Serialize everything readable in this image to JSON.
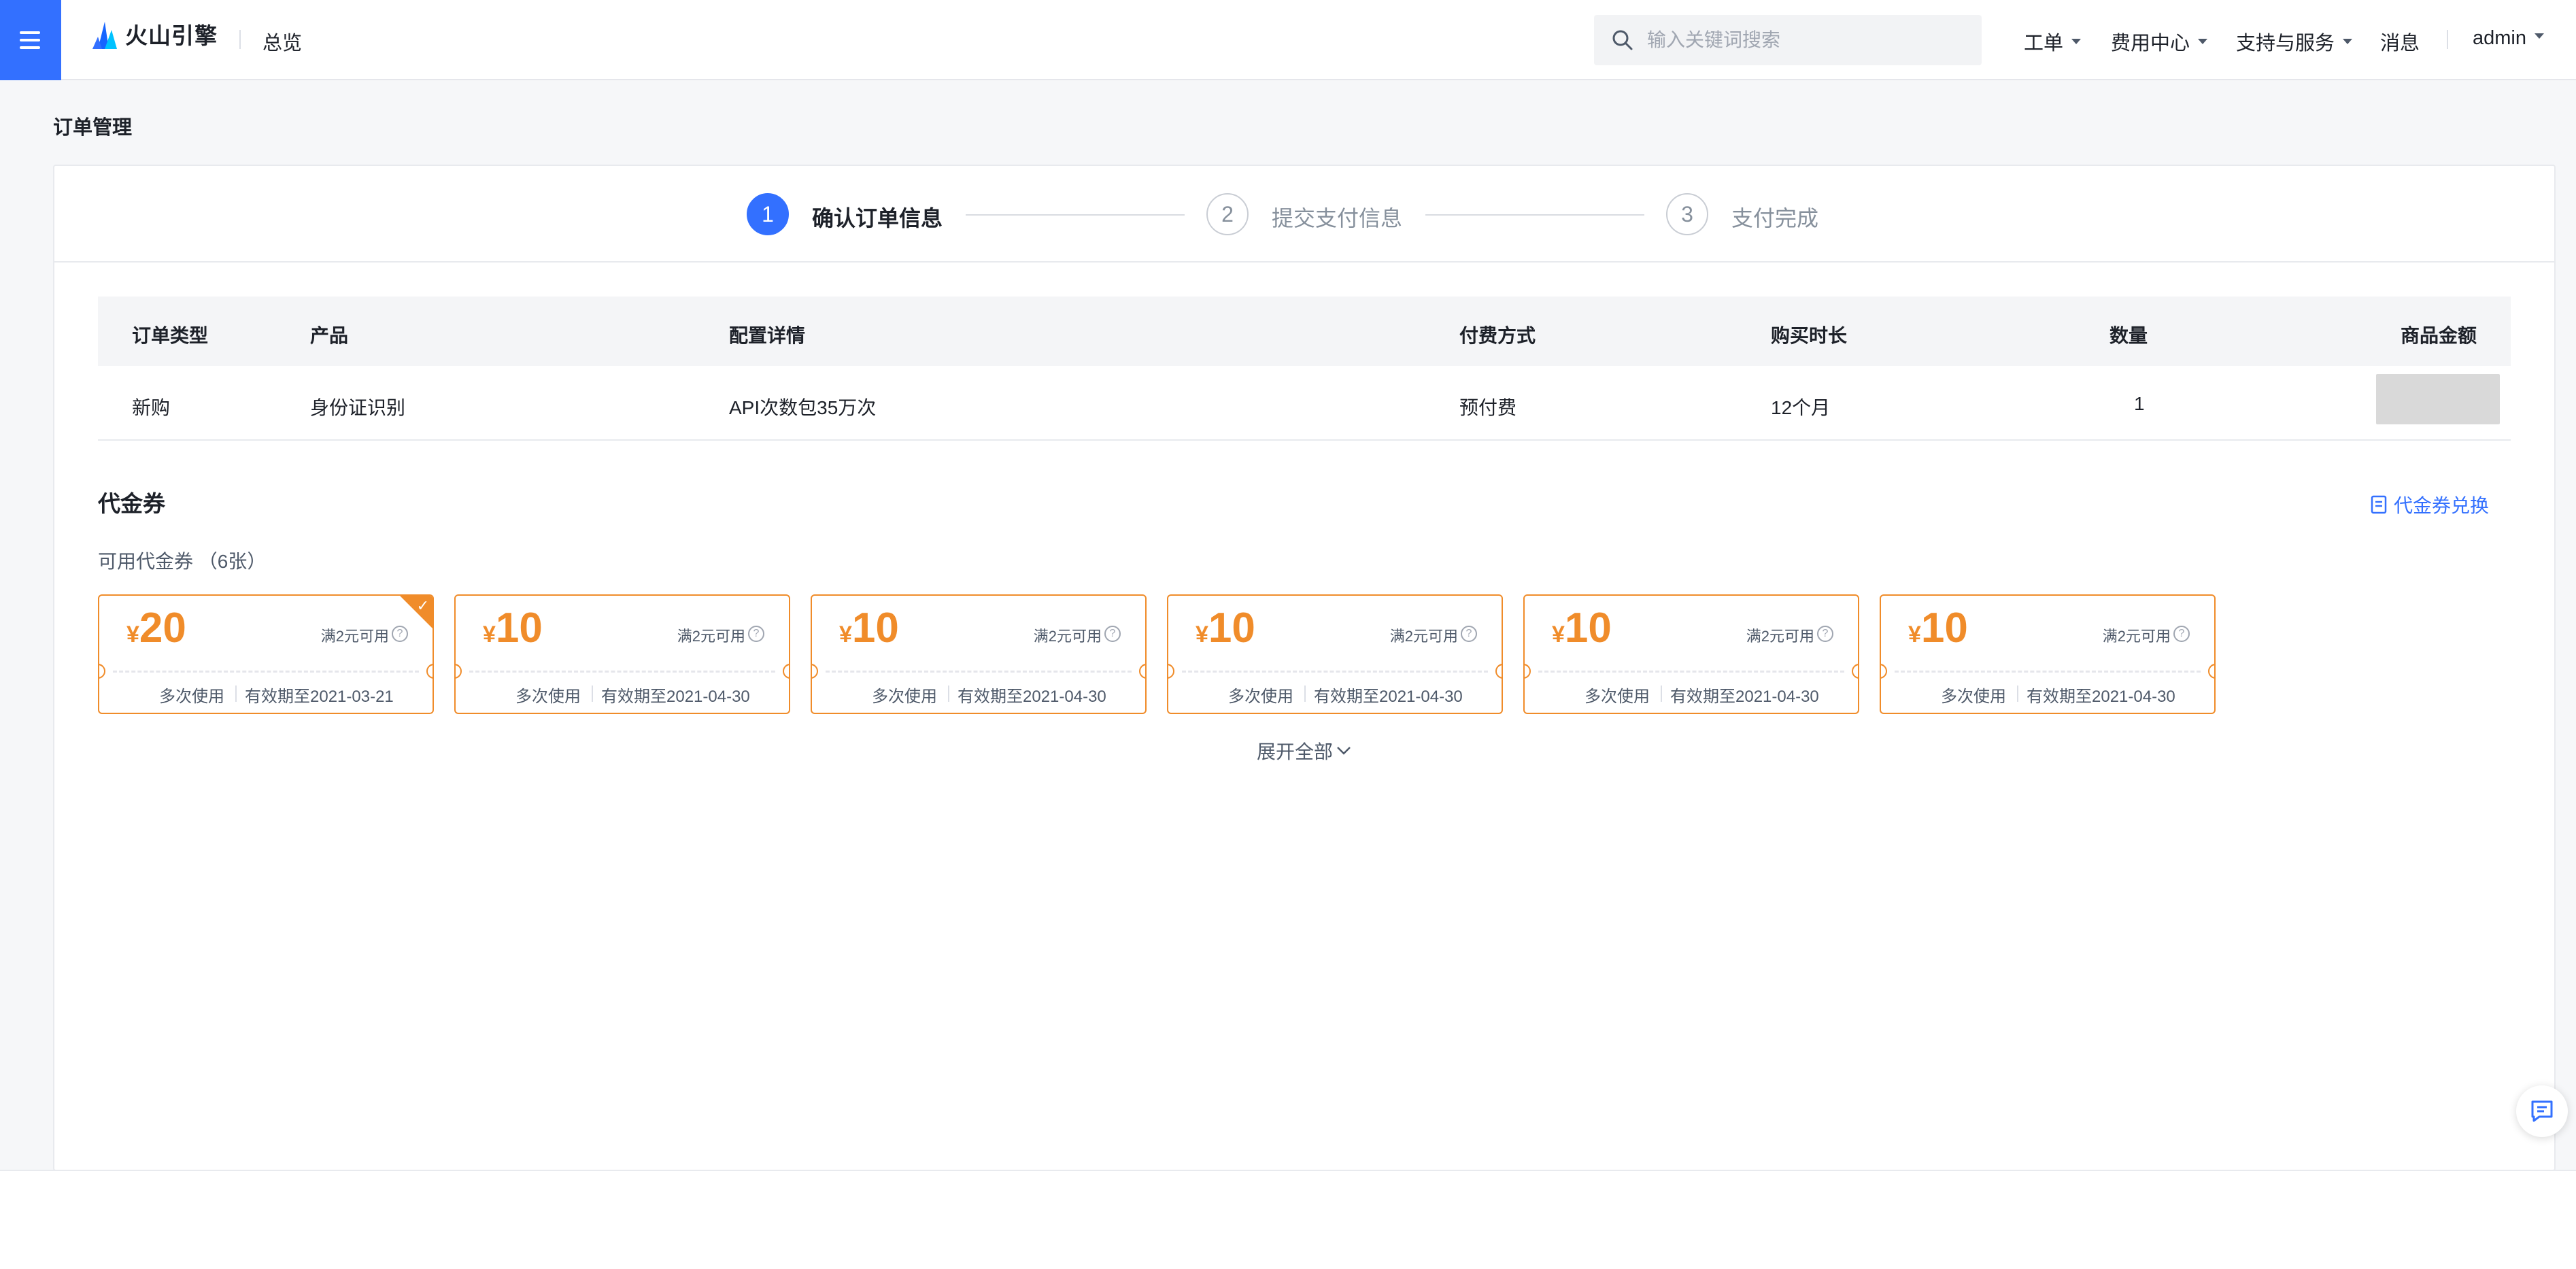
{
  "header": {
    "brand": "火山引擎",
    "overview": "总览",
    "search_placeholder": "输入关键词搜索",
    "nav": [
      "工单",
      "费用中心",
      "支持与服务",
      "消息"
    ],
    "user": "admin"
  },
  "page_title": "订单管理",
  "steps": [
    {
      "num": "1",
      "label": "确认订单信息",
      "active": true
    },
    {
      "num": "2",
      "label": "提交支付信息",
      "active": false
    },
    {
      "num": "3",
      "label": "支付完成",
      "active": false
    }
  ],
  "order_table": {
    "headers": [
      "订单类型",
      "产品",
      "配置详情",
      "付费方式",
      "购买时长",
      "数量",
      "商品金额"
    ],
    "rows": [
      [
        "新购",
        "身份证识别",
        "API次数包35万次",
        "预付费",
        "12个月",
        "1",
        ""
      ]
    ]
  },
  "coupon_section": {
    "title": "代金券",
    "exchange_label": "代金券兑换",
    "available_label": "可用代金券 （6张）",
    "currency": "¥",
    "coupons": [
      {
        "amount": "20",
        "condition": "满2元可用",
        "usage": "多次使用",
        "expiry": "有效期至2021-03-21",
        "selected": true
      },
      {
        "amount": "10",
        "condition": "满2元可用",
        "usage": "多次使用",
        "expiry": "有效期至2021-04-30",
        "selected": false
      },
      {
        "amount": "10",
        "condition": "满2元可用",
        "usage": "多次使用",
        "expiry": "有效期至2021-04-30",
        "selected": false
      },
      {
        "amount": "10",
        "condition": "满2元可用",
        "usage": "多次使用",
        "expiry": "有效期至2021-04-30",
        "selected": false
      },
      {
        "amount": "10",
        "condition": "满2元可用",
        "usage": "多次使用",
        "expiry": "有效期至2021-04-30",
        "selected": false
      },
      {
        "amount": "10",
        "condition": "满2元可用",
        "usage": "多次使用",
        "expiry": "有效期至2021-04-30",
        "selected": false
      }
    ],
    "expand_label": "展开全部"
  },
  "colors": {
    "primary": "#3370ff",
    "coupon_accent": "#f08c2a"
  }
}
